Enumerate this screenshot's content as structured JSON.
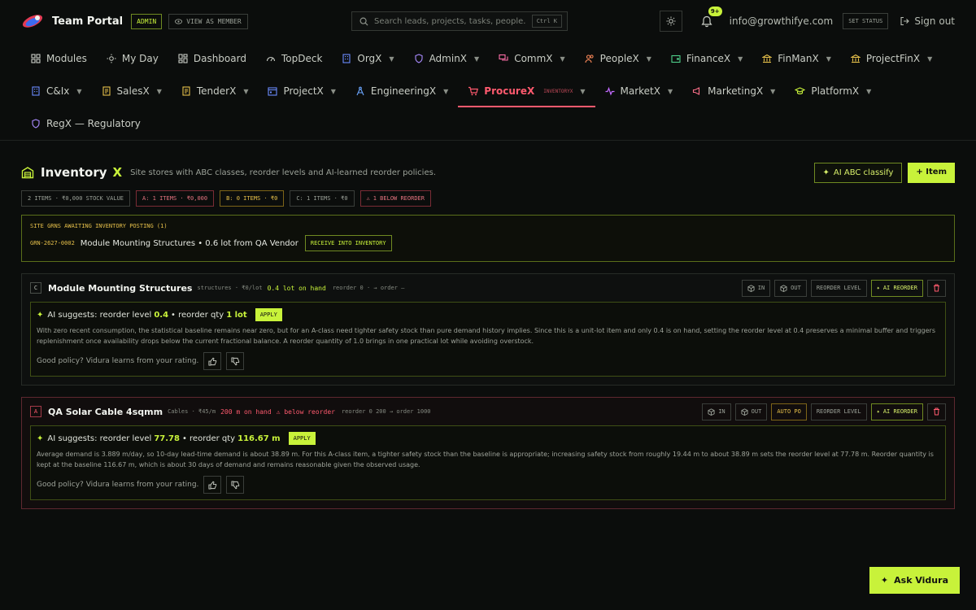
{
  "app": {
    "name": "Team Portal",
    "role_badge": "ADMIN",
    "view_as_label": "VIEW AS MEMBER"
  },
  "search": {
    "placeholder": "Search leads, projects, tasks, people...",
    "shortcut": "Ctrl K"
  },
  "header": {
    "notification_count": "9+",
    "email": "info@growthifye.com",
    "set_status_label": "SET STATUS",
    "sign_out_label": "Sign out"
  },
  "nav": {
    "row1": [
      {
        "label": "Modules",
        "icon": "grid-icon",
        "dropdown": false
      },
      {
        "label": "My Day",
        "icon": "sun-icon",
        "dropdown": false
      },
      {
        "label": "Dashboard",
        "icon": "dashboard-icon",
        "dropdown": false
      },
      {
        "label": "TopDeck",
        "icon": "gauge-icon",
        "dropdown": false
      },
      {
        "label": "OrgX",
        "icon": "building-icon",
        "dropdown": true
      },
      {
        "label": "AdminX",
        "icon": "shield-icon",
        "dropdown": true
      },
      {
        "label": "CommX",
        "icon": "chat-icon",
        "dropdown": true
      },
      {
        "label": "PeopleX",
        "icon": "people-icon",
        "dropdown": true
      },
      {
        "label": "FinanceX",
        "icon": "wallet-icon",
        "dropdown": true
      },
      {
        "label": "FinManX",
        "icon": "bank-icon",
        "dropdown": true
      },
      {
        "label": "ProjectFinX",
        "icon": "bank-icon",
        "dropdown": true
      }
    ],
    "row2": [
      {
        "label": "C&Ix",
        "icon": "building-icon",
        "dropdown": true
      },
      {
        "label": "SalesX",
        "icon": "doc-icon",
        "dropdown": true
      },
      {
        "label": "TenderX",
        "icon": "doc-icon",
        "dropdown": true
      },
      {
        "label": "ProjectX",
        "icon": "calendar-icon",
        "dropdown": true
      },
      {
        "label": "EngineeringX",
        "icon": "compass-icon",
        "dropdown": true
      },
      {
        "label": "ProcureX",
        "icon": "cart-icon",
        "dropdown": true,
        "active": true,
        "tag": "INVENTORYX"
      },
      {
        "label": "MarketX",
        "icon": "pulse-icon",
        "dropdown": true
      },
      {
        "label": "MarketingX",
        "icon": "megaphone-icon",
        "dropdown": true
      },
      {
        "label": "PlatformX",
        "icon": "cap-icon",
        "dropdown": true
      }
    ],
    "row3": [
      {
        "label": "RegX — Regulatory",
        "icon": "shield-icon",
        "dropdown": false
      }
    ]
  },
  "page": {
    "title": "Inventory",
    "title_suffix": "X",
    "subtitle": "Site stores with ABC classes, reorder levels and AI-learned reorder policies.",
    "ai_classify_label": "AI ABC classify",
    "add_item_label": "+ Item"
  },
  "stats": [
    {
      "label": "2 ITEMS · ₹0,000 STOCK VALUE",
      "kind": "neutral"
    },
    {
      "label": "A: 1 ITEMS · ₹0,000",
      "kind": "a"
    },
    {
      "label": "B: 0 ITEMS · ₹0",
      "kind": "b"
    },
    {
      "label": "C: 1 ITEMS · ₹0",
      "kind": "neutral"
    },
    {
      "label": "1 BELOW REORDER",
      "kind": "warn"
    }
  ],
  "grn": {
    "title": "SITE GRNS AWAITING INVENTORY POSTING (1)",
    "id": "GRN-2627-0002",
    "text": "Module Mounting Structures • 0.6 lot from QA Vendor",
    "action_label": "RECEIVE INTO INVENTORY"
  },
  "items": [
    {
      "class": "C",
      "name": "Module Mounting Structures",
      "meta": "structures · ₹0/lot",
      "on_hand": "0.4 lot on hand",
      "below": "",
      "reorder": "reorder 0 · → order –",
      "actions": [
        "IN",
        "OUT",
        "REORDER LEVEL",
        "AI REORDER"
      ],
      "ai": {
        "prefix": "AI suggests: reorder level",
        "level": "0.4",
        "mid": "• reorder qty",
        "qty": "1 lot",
        "apply": "APPLY",
        "reason": "With zero recent consumption, the statistical baseline remains near zero, but for an A-class need tighter safety stock than pure demand history implies. Since this is a unit-lot item and only 0.4 is on hand, setting the reorder level at 0.4 preserves a minimal buffer and triggers replenishment once availability drops below the current fractional balance. A reorder quantity of 1.0 brings in one practical lot while avoiding overstock.",
        "rate_label": "Good policy? Vidura learns from your rating."
      }
    },
    {
      "class": "A",
      "name": "QA Solar Cable 4sqmm",
      "meta": "Cables · ₹45/m",
      "on_hand": "200 m on hand",
      "below": "⚠ below reorder",
      "reorder": "reorder 0 200 → order 1000",
      "actions": [
        "IN",
        "OUT",
        "AUTO PO",
        "REORDER LEVEL",
        "AI REORDER"
      ],
      "ai": {
        "prefix": "AI suggests: reorder level",
        "level": "77.78",
        "mid": "• reorder qty",
        "qty": "116.67 m",
        "apply": "APPLY",
        "reason": "Average demand is 3.889 m/day, so 10-day lead-time demand is about 38.89 m. For this A-class item, a tighter safety stock than the baseline is appropriate; increasing safety stock from roughly 19.44 m to about 38.89 m sets the reorder level at 77.78 m. Reorder quantity is kept at the baseline 116.67 m, which is about 30 days of demand and remains reasonable given the observed usage.",
        "rate_label": "Good policy? Vidura learns from your rating."
      }
    }
  ],
  "fab": {
    "label": "Ask Vidura"
  },
  "colors": {
    "accent": "#c8f23a",
    "active": "#ff5a6e",
    "warning": "#e6c04a",
    "background": "#0b0d0c"
  }
}
